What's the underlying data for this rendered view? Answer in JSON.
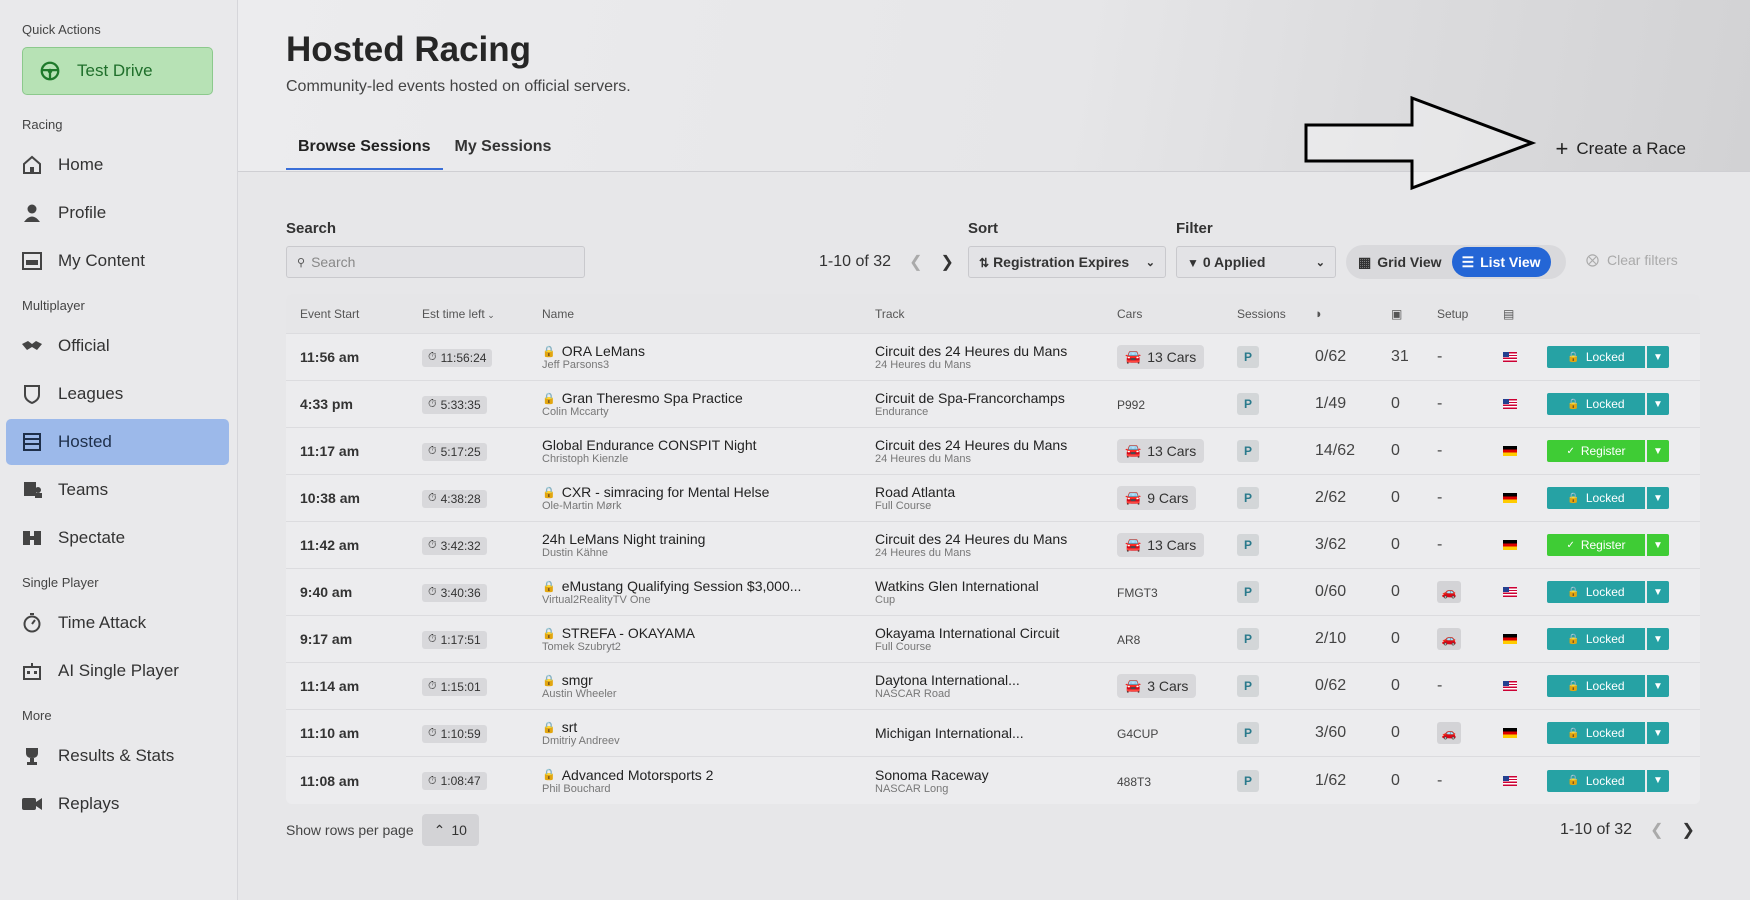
{
  "sidebar": {
    "quick_actions_label": "Quick Actions",
    "test_drive": "Test Drive",
    "racing_label": "Racing",
    "home": "Home",
    "profile": "Profile",
    "my_content": "My Content",
    "multiplayer_label": "Multiplayer",
    "official": "Official",
    "leagues": "Leagues",
    "hosted": "Hosted",
    "teams": "Teams",
    "spectate": "Spectate",
    "single_player_label": "Single Player",
    "time_attack": "Time Attack",
    "ai_single_player": "AI Single Player",
    "more_label": "More",
    "results_stats": "Results & Stats",
    "replays": "Replays"
  },
  "header": {
    "title": "Hosted Racing",
    "subtitle": "Community-led events hosted on official servers.",
    "tabs": [
      "Browse Sessions",
      "My Sessions"
    ],
    "create_race": "Create a Race"
  },
  "controls": {
    "search_label": "Search",
    "search_placeholder": "Search",
    "pager": "1-10 of 32",
    "sort_label": "Sort",
    "sort_value": "Registration Expires",
    "filter_label": "Filter",
    "filter_value": "0 Applied",
    "grid_view": "Grid View",
    "list_view": "List View",
    "clear_filters": "Clear filters"
  },
  "table": {
    "headers": {
      "event_start": "Event Start",
      "est_time_left": "Est time left",
      "name": "Name",
      "track": "Track",
      "cars": "Cars",
      "sessions": "Sessions",
      "setup": "Setup"
    },
    "rows": [
      {
        "start": "11:56 am",
        "est": "11:56:24",
        "locked": true,
        "name": "ORA LeMans",
        "host": "Jeff Parsons3",
        "track": "Circuit des 24 Heures du Mans",
        "config": "24 Heures du Mans",
        "cars_pill": "13 Cars",
        "cars_code": "",
        "session": "P",
        "reg": "0/62",
        "count": "31",
        "setup": "-",
        "flag": "us",
        "action": "Locked"
      },
      {
        "start": "4:33 pm",
        "est": "5:33:35",
        "locked": true,
        "name": "Gran Theresmo Spa Practice",
        "host": "Colin Mccarty",
        "track": "Circuit de Spa-Francorchamps",
        "config": "Endurance",
        "cars_pill": "",
        "cars_code": "P992",
        "session": "P",
        "reg": "1/49",
        "count": "0",
        "setup": "-",
        "flag": "us",
        "action": "Locked"
      },
      {
        "start": "11:17 am",
        "est": "5:17:25",
        "locked": false,
        "name": "Global Endurance CONSPIT Night",
        "host": "Christoph Kienzle",
        "track": "Circuit des 24 Heures du Mans",
        "config": "24 Heures du Mans",
        "cars_pill": "13 Cars",
        "cars_code": "",
        "session": "P",
        "reg": "14/62",
        "count": "0",
        "setup": "-",
        "flag": "de",
        "action": "Register"
      },
      {
        "start": "10:38 am",
        "est": "4:38:28",
        "locked": true,
        "name": "CXR - simracing for Mental Helse",
        "host": "Ole-Martin Mørk",
        "track": "Road Atlanta",
        "config": "Full Course",
        "cars_pill": "9 Cars",
        "cars_code": "",
        "session": "P",
        "reg": "2/62",
        "count": "0",
        "setup": "-",
        "flag": "de",
        "action": "Locked"
      },
      {
        "start": "11:42 am",
        "est": "3:42:32",
        "locked": false,
        "name": "24h LeMans Night training",
        "host": "Dustin Kähne",
        "track": "Circuit des 24 Heures du Mans",
        "config": "24 Heures du Mans",
        "cars_pill": "13 Cars",
        "cars_code": "",
        "session": "P",
        "reg": "3/62",
        "count": "0",
        "setup": "-",
        "flag": "de",
        "action": "Register"
      },
      {
        "start": "9:40 am",
        "est": "3:40:36",
        "locked": true,
        "name": "eMustang Qualifying Session $3,000...",
        "host": "Virtual2RealityTV One",
        "track": "Watkins Glen International",
        "config": "Cup",
        "cars_pill": "",
        "cars_code": "FMGT3",
        "session": "P",
        "reg": "0/60",
        "count": "0",
        "setup": "icon",
        "flag": "us",
        "action": "Locked"
      },
      {
        "start": "9:17 am",
        "est": "1:17:51",
        "locked": true,
        "name": "STREFA - OKAYAMA",
        "host": "Tomek Szubryt2",
        "track": "Okayama International Circuit",
        "config": "Full Course",
        "cars_pill": "",
        "cars_code": "AR8",
        "session": "P",
        "reg": "2/10",
        "count": "0",
        "setup": "icon",
        "flag": "de",
        "action": "Locked"
      },
      {
        "start": "11:14 am",
        "est": "1:15:01",
        "locked": true,
        "name": "smgr",
        "host": "Austin Wheeler",
        "track": "Daytona International...",
        "config": "NASCAR Road",
        "cars_pill": "3 Cars",
        "cars_code": "",
        "session": "P",
        "reg": "0/62",
        "count": "0",
        "setup": "-",
        "flag": "us",
        "action": "Locked"
      },
      {
        "start": "11:10 am",
        "est": "1:10:59",
        "locked": true,
        "name": "srt",
        "host": "Dmitriy Andreev",
        "track": "Michigan International...",
        "config": "",
        "cars_pill": "",
        "cars_code": "G4CUP",
        "session": "P",
        "reg": "3/60",
        "count": "0",
        "setup": "icon",
        "flag": "de",
        "action": "Locked"
      },
      {
        "start": "11:08 am",
        "est": "1:08:47",
        "locked": true,
        "name": "Advanced Motorsports 2",
        "host": "Phil Bouchard",
        "track": "Sonoma Raceway",
        "config": "NASCAR Long",
        "cars_pill": "",
        "cars_code": "488T3",
        "session": "P",
        "reg": "1/62",
        "count": "0",
        "setup": "-",
        "flag": "us",
        "action": "Locked"
      }
    ]
  },
  "footer": {
    "rows_per_page_label": "Show rows per page",
    "rows_per_page_value": "10",
    "pager": "1-10 of 32"
  },
  "colors": {
    "accent_blue": "#2466d6",
    "locked_teal": "#26a2a4",
    "register_green": "#3fcc35",
    "active_sidebar": "#9cb9ea"
  }
}
